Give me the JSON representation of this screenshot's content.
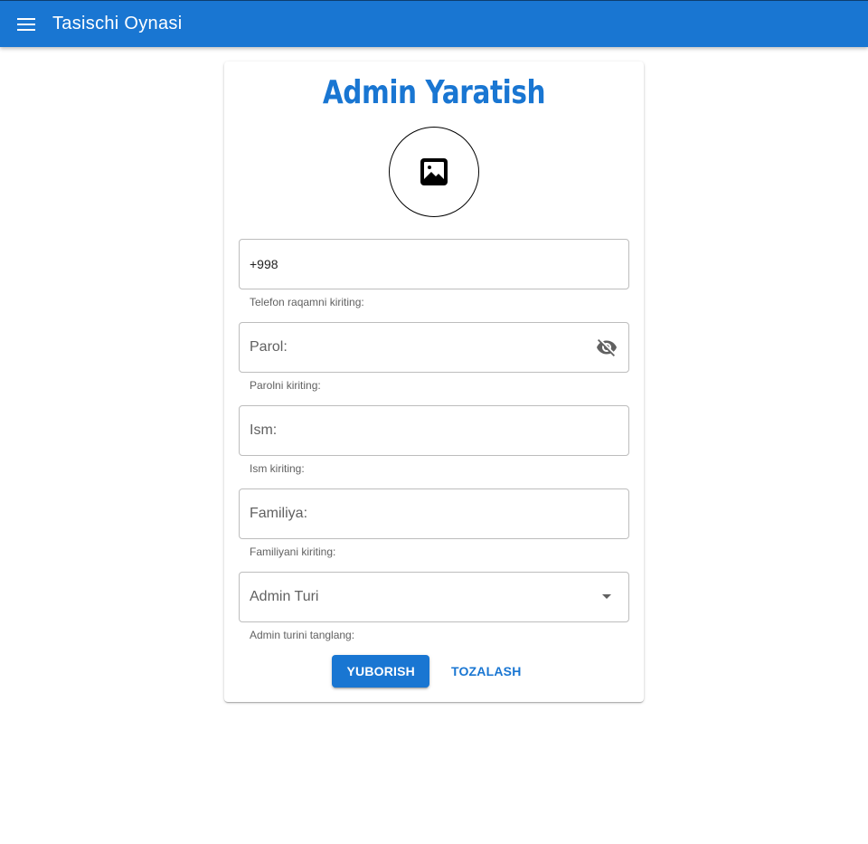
{
  "app_bar": {
    "title": "Tasischi Oynasi",
    "menu_icon": "menu-icon",
    "color": "#1976d2"
  },
  "form": {
    "title": "Admin Yaratish",
    "avatar_icon": "image-icon",
    "phone": {
      "value": "+998",
      "hint": "Telefon raqamni kiriting:"
    },
    "password": {
      "placeholder": "Parol:",
      "hint": "Parolni kiriting:",
      "toggle_icon": "eye-off-icon"
    },
    "first_name": {
      "placeholder": "Ism:",
      "hint": "Ism kiriting:"
    },
    "last_name": {
      "placeholder": "Familiya:",
      "hint": "Familiyani kiriting:"
    },
    "admin_type": {
      "label": "Admin Turi",
      "hint": "Admin turini tanglang:",
      "dropdown_icon": "arrow-drop-down-icon"
    },
    "submit_label": "YUBORISH",
    "reset_label": "TOZALASH"
  }
}
